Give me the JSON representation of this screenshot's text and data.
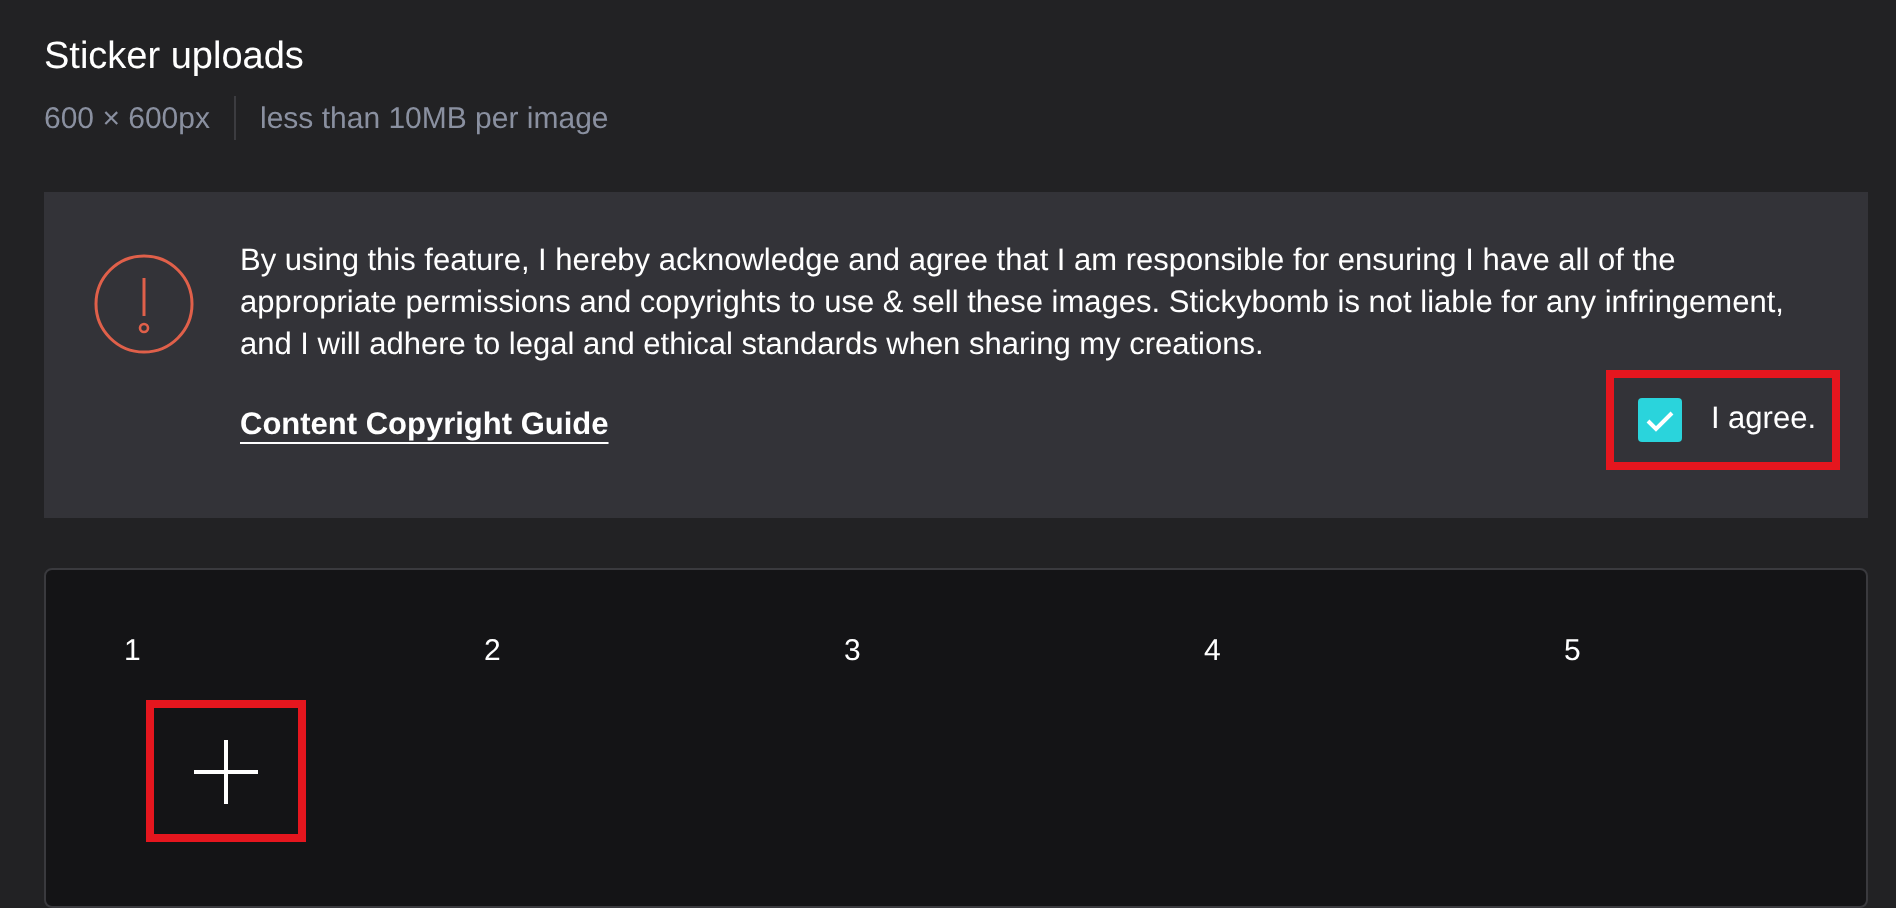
{
  "header": {
    "title": "Sticker uploads",
    "size": "600 × 600px",
    "limit": "less than 10MB per image"
  },
  "notice": {
    "text": "By using this feature, I hereby acknowledge and agree that I am responsible for ensuring I have all of the appropriate permissions and copyrights to use & sell these images. Stickybomb is not liable for any infringement, and I will adhere to legal and ethical standards when sharing my creations.",
    "link": "Content Copyright Guide",
    "agree": {
      "label": "I agree.",
      "checked": true,
      "highlighted": true
    }
  },
  "slots": [
    {
      "label": "1",
      "kind": "add",
      "highlighted": true
    },
    {
      "label": "2",
      "kind": "empty"
    },
    {
      "label": "3",
      "kind": "empty"
    },
    {
      "label": "4",
      "kind": "empty"
    },
    {
      "label": "5",
      "kind": "empty"
    }
  ]
}
